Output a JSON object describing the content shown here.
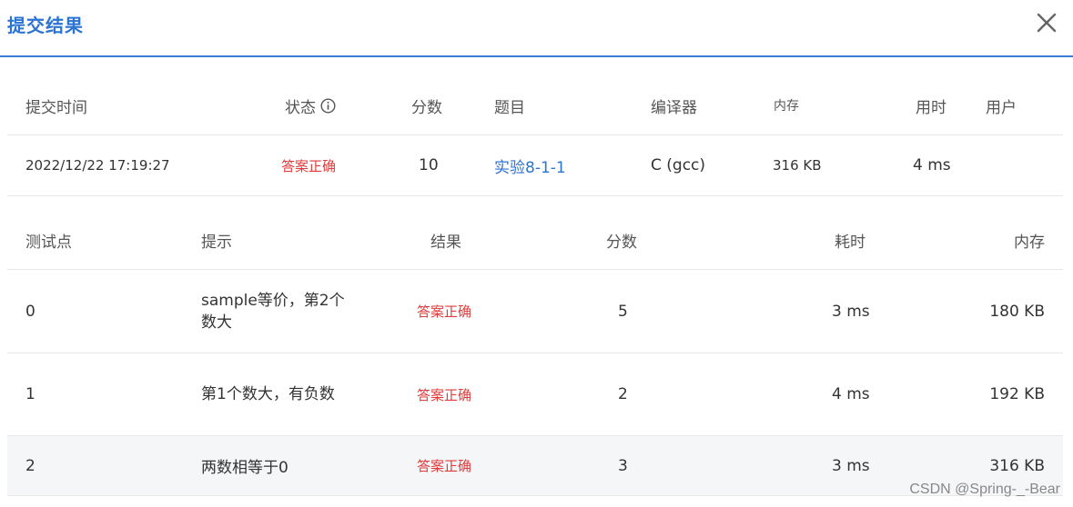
{
  "dialog": {
    "title": "提交结果",
    "close_icon": "close-icon"
  },
  "submission_table": {
    "headers": {
      "time": "提交时间",
      "status": "状态",
      "score": "分数",
      "problem": "题目",
      "compiler": "编译器",
      "memory": "内存",
      "duration": "用时",
      "user": "用户"
    },
    "row": {
      "time": "2022/12/22 17:19:27",
      "status": "答案正确",
      "score": "10",
      "problem": "实验8-1-1",
      "compiler": "C (gcc)",
      "memory": "316 KB",
      "duration": "4 ms",
      "user": ""
    }
  },
  "testcase_table": {
    "headers": {
      "case": "测试点",
      "hint": "提示",
      "result": "结果",
      "score": "分数",
      "duration": "耗时",
      "memory": "内存"
    },
    "rows": [
      {
        "case": "0",
        "hint": "sample等价，第2个数大",
        "result": "答案正确",
        "score": "5",
        "duration": "3 ms",
        "memory": "180 KB"
      },
      {
        "case": "1",
        "hint": "第1个数大，有负数",
        "result": "答案正确",
        "score": "2",
        "duration": "4 ms",
        "memory": "192 KB"
      },
      {
        "case": "2",
        "hint": "两数相等于0",
        "result": "答案正确",
        "score": "3",
        "duration": "3 ms",
        "memory": "316 KB"
      }
    ]
  },
  "colors": {
    "accent": "#2c74d3",
    "status_ok": "#e03b3b",
    "row_alt": "#f5f6f8"
  },
  "watermark": "CSDN @Spring-_-Bear"
}
